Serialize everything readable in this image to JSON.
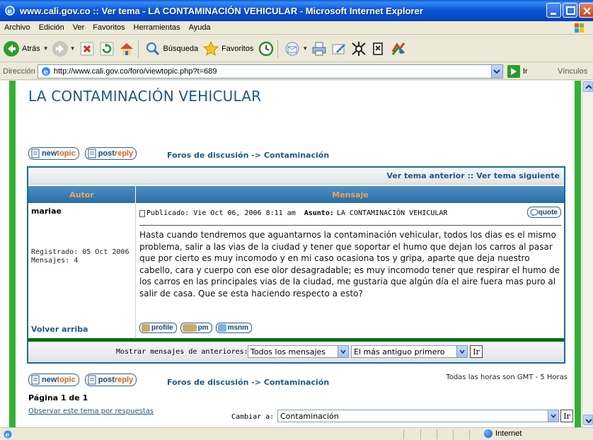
{
  "window": {
    "title": "www.cali.gov.co :: Ver tema - LA CONTAMINACIÓN VEHICULAR - Microsoft Internet Explorer"
  },
  "menu": [
    "Archivo",
    "Edición",
    "Ver",
    "Favoritos",
    "Herramientas",
    "Ayuda"
  ],
  "toolbar": {
    "back_label": "Atrás",
    "search_label": "Búsqueda",
    "favorites_label": "Favoritos"
  },
  "addressbar": {
    "label": "Dirección",
    "url": "http://www.cali.gov.co/foro/viewtopic.php?t=689",
    "go_label": "Ir",
    "links_label": "Vínculos"
  },
  "topic": {
    "title": "LA CONTAMINACIÓN VEHICULAR",
    "btn_new_a": "new",
    "btn_new_b": "topic",
    "btn_reply_a": "post",
    "btn_reply_b": "reply",
    "breadcrumb": "Foros de discusión -> Contaminación",
    "prev_topic": "Ver tema anterior",
    "sep": "::",
    "next_topic": "Ver tema siguiente",
    "col_author": "Autor",
    "col_message": "Mensaje"
  },
  "post": {
    "author": "mariae",
    "registered": "Registrado: 05 Oct 2006",
    "messages": "Mensajes: 4",
    "posted": "Publicado: Vie Oct 06, 2006 8:11 am",
    "subject_label": "Asunto:",
    "subject": "LA CONTAMINACIÓN VEHICULAR",
    "quote_label": "quote",
    "body": "Hasta cuando tendremos que aguantarnos la contaminación vehicular, todos los dias es el mismo problema, salir a las vias de la ciudad y tener que soportar el humo que dejan los carros al pasar que por cierto es muy incomodo y en mi caso ocasiona tos y gripa, aparte que deja nuestro cabello, cara y cuerpo con ese olor desagradable; es muy incomodo tener que respirar el humo de los carros en las principales vias de la ciudad, me gustaria que algún día el aire fuera mas puro al salir de casa. Que se esta haciendo respecto a esto?",
    "back_to_top": "Volver arriba",
    "btn_profile": "profile",
    "btn_pm": "pm",
    "btn_msnm": "msnm"
  },
  "filter": {
    "label": "Mostrar mensajes de anteriores:",
    "period": "Todos los mensajes",
    "order": "El más antiguo primero",
    "go": "Ir"
  },
  "footer": {
    "timezone": "Todas las horas son GMT - 5 Horas",
    "page_info": "Página 1 de 1",
    "watch_link": "Observar este tema por respuestas",
    "jump_label": "Cambiar a:",
    "jump_value": "Contaminación",
    "jump_go": "Ir"
  },
  "status": {
    "zone": "Internet"
  }
}
